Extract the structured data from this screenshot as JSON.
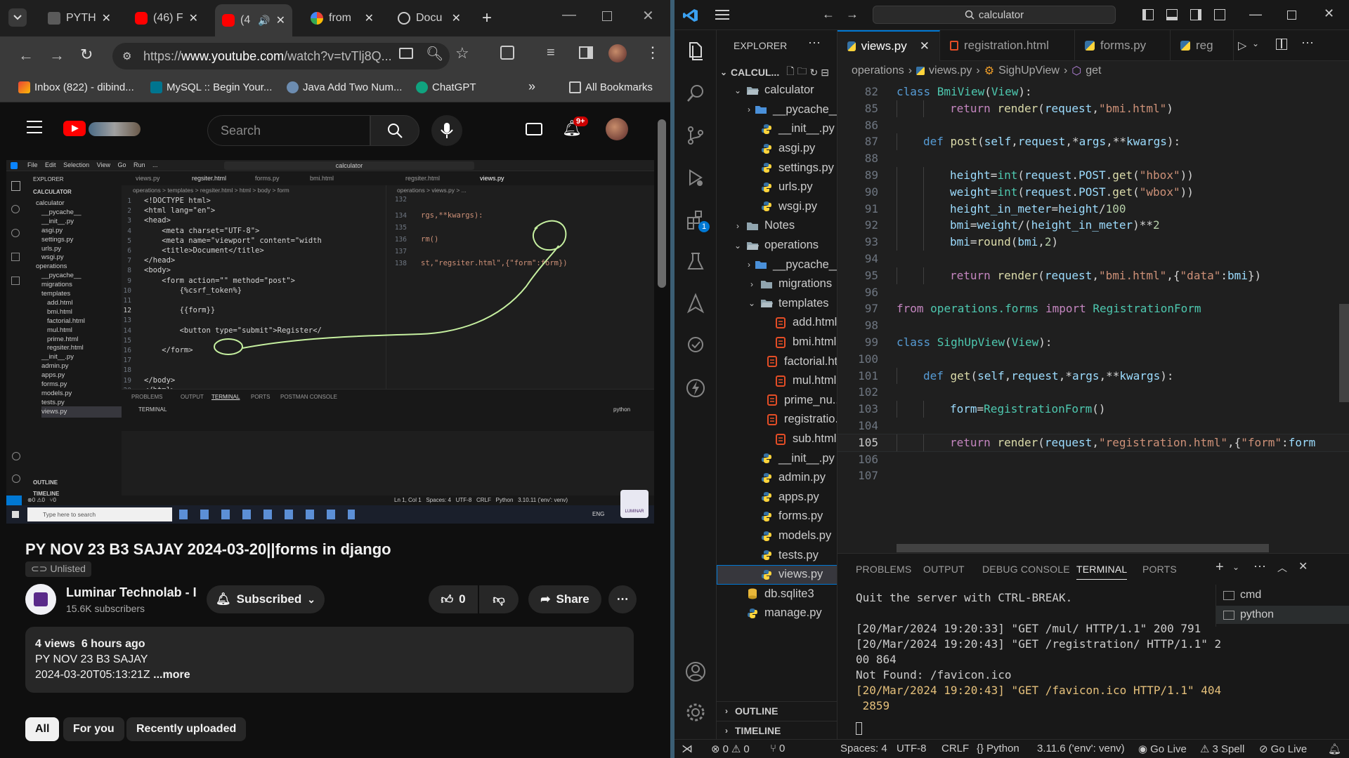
{
  "chrome": {
    "tabs": [
      {
        "title": "PYTH",
        "icon": "page-icon"
      },
      {
        "title": "(46) F",
        "icon": "youtube-icon"
      },
      {
        "title": "(4",
        "icon": "youtube-icon"
      },
      {
        "title": "from",
        "icon": "google-icon"
      },
      {
        "title": "Docu",
        "icon": "globe-icon"
      }
    ],
    "url_prefix": "https://",
    "url_host": "www.youtube.com",
    "url_path": "/watch?v=tvTlj8Q...",
    "bookmarks": [
      {
        "label": "Inbox (822) - dibind..."
      },
      {
        "label": "MySQL :: Begin Your..."
      },
      {
        "label": "Java Add Two Num..."
      },
      {
        "label": "ChatGPT"
      }
    ],
    "all_bookmarks": "All Bookmarks",
    "more_bookmarks": "»"
  },
  "youtube": {
    "search_placeholder": "Search",
    "notif_badge": "9+",
    "video_title": "PY NOV 23 B3 SAJAY 2024-03-20||forms in django",
    "visibility": "Unlisted",
    "channel_name": "Luminar Technolab - I",
    "subscribers": "15.6K subscribers",
    "subscribe_label": "Subscribed",
    "likes": "0",
    "share_label": "Share",
    "views": "4 views",
    "posted": "6 hours ago",
    "desc_line1": "PY NOV 23 B3 SAJAY",
    "desc_line2": "2024-03-20T05:13:21Z",
    "more_label": "...more",
    "chips": [
      "All",
      "For you",
      "Recently uploaded"
    ]
  },
  "mini": {
    "search": "calculator",
    "explorer": "EXPLORER",
    "project": "CALCULATOR",
    "menu": [
      "File",
      "Edit",
      "Selection",
      "View",
      "Go",
      "Run",
      "..."
    ],
    "tabs": [
      "views.py",
      "regsiter.html",
      "forms.py",
      "bmi.html",
      "regsiter.html",
      "views.py"
    ],
    "crumbs_left": "operations > templates > regsiter.html > html > body > form",
    "crumbs_right": "operations > views.py > ...",
    "tree": [
      "calculator",
      "__pycache__",
      "__init__.py",
      "asgi.py",
      "settings.py",
      "urls.py",
      "wsgi.py",
      "operations",
      "__pycache__",
      "migrations",
      "templates",
      "add.html",
      "bmi.html",
      "factorial.html",
      "mul.html",
      "prime.html",
      "regsiter.html",
      "__init__.py",
      "admin.py",
      "apps.py",
      "forms.py",
      "models.py",
      "tests.py",
      "views.py"
    ],
    "outline": "OUTLINE",
    "timeline": "TIMELINE",
    "html_lines": [
      {
        "n": "1",
        "t": "<!DOCTYPE html>"
      },
      {
        "n": "2",
        "t": "<html lang=\"en\">"
      },
      {
        "n": "3",
        "t": "<head>"
      },
      {
        "n": "4",
        "t": "    <meta charset=\"UTF-8\">"
      },
      {
        "n": "5",
        "t": "    <meta name=\"viewport\" content=\"width"
      },
      {
        "n": "6",
        "t": "    <title>Document</title>"
      },
      {
        "n": "7",
        "t": "</head>"
      },
      {
        "n": "8",
        "t": "<body>"
      },
      {
        "n": "9",
        "t": "    <form action=\"\" method=\"post\">"
      },
      {
        "n": "10",
        "t": "        {%csrf_token%}"
      },
      {
        "n": "11",
        "t": ""
      },
      {
        "n": "12",
        "t": "        {{form}}"
      },
      {
        "n": "13",
        "t": ""
      },
      {
        "n": "14",
        "t": "        <button type=\"submit\">Register</"
      },
      {
        "n": "15",
        "t": ""
      },
      {
        "n": "16",
        "t": "    </form>"
      },
      {
        "n": "17",
        "t": ""
      },
      {
        "n": "18",
        "t": ""
      },
      {
        "n": "19",
        "t": "</body>"
      },
      {
        "n": "20",
        "t": "</html>"
      }
    ],
    "py_lines": [
      {
        "n": "132",
        "t": ""
      },
      {
        "n": "134",
        "t": "rgs,**kwargs):"
      },
      {
        "n": "135",
        "t": ""
      },
      {
        "n": "136",
        "t": "rm()"
      },
      {
        "n": "137",
        "t": ""
      },
      {
        "n": "138",
        "t": "st,\"regsiter.html\",{\"form\":form})"
      }
    ],
    "panel_tabs": [
      "PROBLEMS",
      "OUTPUT",
      "TERMINAL",
      "PORTS",
      "POSTMAN CONSOLE"
    ],
    "terminal_label": "TERMINAL",
    "status": "Ln 1, Col 1   Spaces: 4   UTF-8   CRLF   Python   3.10.11 ('env': venv)",
    "status_left": "⊗0 ⚠0   ⑂0",
    "taskbar_search": "Type here to search",
    "taskbar_lang": "ENG",
    "python_label": "python",
    "luminar": "LUMINAR"
  },
  "vscode": {
    "search": "calculator",
    "explorer_title": "EXPLORER",
    "root": "CALCUL...",
    "tree": [
      {
        "label": "calculator",
        "depth": 1,
        "type": "folder-open",
        "chev": "v"
      },
      {
        "label": "__pycache__",
        "depth": 2,
        "type": "folder",
        "chev": ">"
      },
      {
        "label": "__init__.py",
        "depth": 2,
        "type": "py"
      },
      {
        "label": "asgi.py",
        "depth": 2,
        "type": "py"
      },
      {
        "label": "settings.py",
        "depth": 2,
        "type": "py"
      },
      {
        "label": "urls.py",
        "depth": 2,
        "type": "py"
      },
      {
        "label": "wsgi.py",
        "depth": 2,
        "type": "py"
      },
      {
        "label": "Notes",
        "depth": 1,
        "type": "folder",
        "chev": ">"
      },
      {
        "label": "operations",
        "depth": 1,
        "type": "folder-open",
        "chev": "v"
      },
      {
        "label": "__pycache__",
        "depth": 2,
        "type": "folder",
        "chev": ">"
      },
      {
        "label": "migrations",
        "depth": 2,
        "type": "folder",
        "chev": ">"
      },
      {
        "label": "templates",
        "depth": 2,
        "type": "folder-open",
        "chev": "v"
      },
      {
        "label": "add.html",
        "depth": 3,
        "type": "html"
      },
      {
        "label": "bmi.html",
        "depth": 3,
        "type": "html"
      },
      {
        "label": "factorial.ht...",
        "depth": 3,
        "type": "html"
      },
      {
        "label": "mul.html",
        "depth": 3,
        "type": "html"
      },
      {
        "label": "prime_nu...",
        "depth": 3,
        "type": "html"
      },
      {
        "label": "registratio...",
        "depth": 3,
        "type": "html"
      },
      {
        "label": "sub.html",
        "depth": 3,
        "type": "html"
      },
      {
        "label": "__init__.py",
        "depth": 2,
        "type": "py"
      },
      {
        "label": "admin.py",
        "depth": 2,
        "type": "py"
      },
      {
        "label": "apps.py",
        "depth": 2,
        "type": "py"
      },
      {
        "label": "forms.py",
        "depth": 2,
        "type": "py"
      },
      {
        "label": "models.py",
        "depth": 2,
        "type": "py"
      },
      {
        "label": "tests.py",
        "depth": 2,
        "type": "py"
      },
      {
        "label": "views.py",
        "depth": 2,
        "type": "py",
        "selected": true
      },
      {
        "label": "db.sqlite3",
        "depth": 1,
        "type": "db"
      },
      {
        "label": "manage.py",
        "depth": 1,
        "type": "py"
      }
    ],
    "outline": "OUTLINE",
    "timeline": "TIMELINE",
    "tabs": [
      {
        "label": "views.py",
        "type": "py",
        "active": true
      },
      {
        "label": "registration.html",
        "type": "html"
      },
      {
        "label": "forms.py",
        "type": "py"
      },
      {
        "label": "reg",
        "type": "py"
      }
    ],
    "breadcrumbs": [
      "operations",
      "views.py",
      "SighUpView",
      "get"
    ],
    "code": [
      {
        "n": "82",
        "indent": 0,
        "tokens": [
          [
            "kw",
            "class "
          ],
          [
            "cls",
            "BmiView"
          ],
          [
            "op",
            "("
          ],
          [
            "cls",
            "View"
          ],
          [
            "op",
            "):"
          ]
        ]
      },
      {
        "n": "85",
        "indent": 2,
        "tokens": [
          [
            "kw2",
            "return "
          ],
          [
            "fn",
            "render"
          ],
          [
            "op",
            "("
          ],
          [
            "var",
            "request"
          ],
          [
            "op",
            ","
          ],
          [
            "str",
            "\"bmi.html\""
          ],
          [
            "op",
            ")"
          ]
        ]
      },
      {
        "n": "86",
        "indent": 0,
        "tokens": []
      },
      {
        "n": "87",
        "indent": 1,
        "tokens": [
          [
            "kw",
            "def "
          ],
          [
            "fn",
            "post"
          ],
          [
            "op",
            "("
          ],
          [
            "var",
            "self"
          ],
          [
            "op",
            ","
          ],
          [
            "var",
            "request"
          ],
          [
            "op",
            ","
          ],
          [
            "op",
            "*"
          ],
          [
            "var",
            "args"
          ],
          [
            "op",
            ",**"
          ],
          [
            "var",
            "kwargs"
          ],
          [
            "op",
            "):"
          ]
        ]
      },
      {
        "n": "88",
        "indent": 0,
        "tokens": []
      },
      {
        "n": "89",
        "indent": 2,
        "tokens": [
          [
            "var",
            "height"
          ],
          [
            "op",
            "="
          ],
          [
            "cls",
            "int"
          ],
          [
            "op",
            "("
          ],
          [
            "var",
            "request"
          ],
          [
            "op",
            "."
          ],
          [
            "var",
            "POST"
          ],
          [
            "op",
            "."
          ],
          [
            "fn",
            "get"
          ],
          [
            "op",
            "("
          ],
          [
            "str",
            "\"hbox\""
          ],
          [
            "op",
            "))"
          ]
        ]
      },
      {
        "n": "90",
        "indent": 2,
        "tokens": [
          [
            "var",
            "weight"
          ],
          [
            "op",
            "="
          ],
          [
            "cls",
            "int"
          ],
          [
            "op",
            "("
          ],
          [
            "var",
            "request"
          ],
          [
            "op",
            "."
          ],
          [
            "var",
            "POST"
          ],
          [
            "op",
            "."
          ],
          [
            "fn",
            "get"
          ],
          [
            "op",
            "("
          ],
          [
            "str",
            "\"wbox\""
          ],
          [
            "op",
            "))"
          ]
        ]
      },
      {
        "n": "91",
        "indent": 2,
        "tokens": [
          [
            "var",
            "height_in_meter"
          ],
          [
            "op",
            "="
          ],
          [
            "var",
            "height"
          ],
          [
            "op",
            "/"
          ],
          [
            "num",
            "100"
          ]
        ]
      },
      {
        "n": "92",
        "indent": 2,
        "tokens": [
          [
            "var",
            "bmi"
          ],
          [
            "op",
            "="
          ],
          [
            "var",
            "weight"
          ],
          [
            "op",
            "/("
          ],
          [
            "var",
            "height_in_meter"
          ],
          [
            "op",
            ")**"
          ],
          [
            "num",
            "2"
          ]
        ]
      },
      {
        "n": "93",
        "indent": 2,
        "tokens": [
          [
            "var",
            "bmi"
          ],
          [
            "op",
            "="
          ],
          [
            "fn",
            "round"
          ],
          [
            "op",
            "("
          ],
          [
            "var",
            "bmi"
          ],
          [
            "op",
            ","
          ],
          [
            "num",
            "2"
          ],
          [
            "op",
            ")"
          ]
        ]
      },
      {
        "n": "94",
        "indent": 0,
        "tokens": []
      },
      {
        "n": "95",
        "indent": 2,
        "tokens": [
          [
            "kw2",
            "return "
          ],
          [
            "fn",
            "render"
          ],
          [
            "op",
            "("
          ],
          [
            "var",
            "request"
          ],
          [
            "op",
            ","
          ],
          [
            "str",
            "\"bmi.html\""
          ],
          [
            "op",
            ",{"
          ],
          [
            "str",
            "\"data\""
          ],
          [
            "op",
            ":"
          ],
          [
            "var",
            "bmi"
          ],
          [
            "op",
            "})"
          ]
        ]
      },
      {
        "n": "96",
        "indent": 0,
        "tokens": []
      },
      {
        "n": "97",
        "indent": 0,
        "tokens": [
          [
            "kw2",
            "from "
          ],
          [
            "cls",
            "operations.forms "
          ],
          [
            "kw2",
            "import "
          ],
          [
            "cls",
            "RegistrationForm"
          ]
        ]
      },
      {
        "n": "98",
        "indent": 0,
        "tokens": []
      },
      {
        "n": "99",
        "indent": 0,
        "tokens": [
          [
            "kw",
            "class "
          ],
          [
            "cls",
            "SighUpView"
          ],
          [
            "op",
            "("
          ],
          [
            "cls",
            "View"
          ],
          [
            "op",
            "):"
          ]
        ]
      },
      {
        "n": "100",
        "indent": 0,
        "tokens": []
      },
      {
        "n": "101",
        "indent": 1,
        "tokens": [
          [
            "kw",
            "def "
          ],
          [
            "fn",
            "get"
          ],
          [
            "op",
            "("
          ],
          [
            "var",
            "self"
          ],
          [
            "op",
            ","
          ],
          [
            "var",
            "request"
          ],
          [
            "op",
            ","
          ],
          [
            "op",
            "*"
          ],
          [
            "var",
            "args"
          ],
          [
            "op",
            ",**"
          ],
          [
            "var",
            "kwargs"
          ],
          [
            "op",
            "):"
          ]
        ]
      },
      {
        "n": "102",
        "indent": 0,
        "tokens": []
      },
      {
        "n": "103",
        "indent": 2,
        "tokens": [
          [
            "var",
            "form"
          ],
          [
            "op",
            "="
          ],
          [
            "cls",
            "RegistrationForm"
          ],
          [
            "op",
            "()"
          ]
        ]
      },
      {
        "n": "104",
        "indent": 0,
        "tokens": []
      },
      {
        "n": "105",
        "indent": 2,
        "tokens": [
          [
            "kw2",
            "return "
          ],
          [
            "fn",
            "render"
          ],
          [
            "op",
            "("
          ],
          [
            "var",
            "request"
          ],
          [
            "op",
            ","
          ],
          [
            "str",
            "\"registration.html\""
          ],
          [
            "op",
            ",{"
          ],
          [
            "str",
            "\"form\""
          ],
          [
            "op",
            ":"
          ],
          [
            "var",
            "form"
          ]
        ]
      },
      {
        "n": "106",
        "indent": 0,
        "tokens": []
      },
      {
        "n": "107",
        "indent": 0,
        "tokens": []
      }
    ],
    "current_line": "105",
    "panel_tabs": [
      "PROBLEMS",
      "OUTPUT",
      "DEBUG CONSOLE",
      "TERMINAL",
      "PORTS"
    ],
    "active_panel_tab": "TERMINAL",
    "terminal_lines": [
      {
        "t": "Quit the server with CTRL-BREAK.",
        "c": "#cccccc"
      },
      {
        "t": "",
        "c": "#cccccc"
      },
      {
        "t": "[20/Mar/2024 19:20:33] \"GET /mul/ HTTP/1.1\" 200 791",
        "c": "#cccccc"
      },
      {
        "t": "[20/Mar/2024 19:20:43] \"GET /registration/ HTTP/1.1\" 2",
        "c": "#cccccc"
      },
      {
        "t": "00 864",
        "c": "#cccccc"
      },
      {
        "t": "Not Found: /favicon.ico",
        "c": "#cccccc"
      },
      {
        "t": "[20/Mar/2024 19:20:43] \"GET /favicon.ico HTTP/1.1\" 404",
        "c": "#e5c07b"
      },
      {
        "t": " 2859",
        "c": "#e5c07b"
      }
    ],
    "shells": [
      "cmd",
      "python"
    ],
    "status": {
      "errors": "0",
      "warnings": "0",
      "ports": "0",
      "spaces": "Spaces: 4",
      "encoding": "UTF-8",
      "eol": "CRLF",
      "language": "Python",
      "interpreter": "3.11.6 ('env': venv)",
      "golive1": "Go Live",
      "spell": "3 Spell",
      "golive2": "Go Live"
    },
    "extensions_badge": "1"
  }
}
